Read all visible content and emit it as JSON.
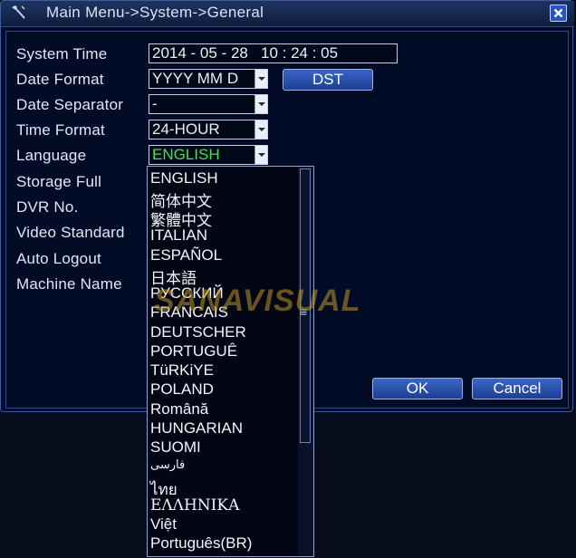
{
  "window": {
    "title": "Main Menu->System->General",
    "icon": "hammer-icon",
    "close_icon": "close-icon"
  },
  "form": {
    "system_time": {
      "label": "System Time",
      "value": "2014 - 05 - 28   10 : 24 : 05"
    },
    "date_format": {
      "label": "Date Format",
      "value": "YYYY MM D"
    },
    "date_separator": {
      "label": "Date Separator",
      "value": "-"
    },
    "time_format": {
      "label": "Time Format",
      "value": "24-HOUR"
    },
    "language": {
      "label": "Language",
      "value": "ENGLISH"
    },
    "storage_full": {
      "label": "Storage Full"
    },
    "dvr_no": {
      "label": "DVR No."
    },
    "video_standard": {
      "label": "Video Standard"
    },
    "auto_logout": {
      "label": "Auto Logout"
    },
    "machine_name": {
      "label": "Machine Name"
    }
  },
  "buttons": {
    "dst": "DST",
    "ok": "OK",
    "cancel": "Cancel"
  },
  "language_options": [
    "ENGLISH",
    "简体中文",
    "繁體中文",
    "ITALIAN",
    "ESPAÑOL",
    "日本語",
    "РУССКИЙ",
    "FRANCAIS",
    "DEUTSCHER",
    "PORTUGUÊ",
    "TüRKiYE",
    "POLAND",
    "Română",
    "HUNGARIAN",
    "SUOMI",
    "فارسی",
    "ไทย",
    "ΕΛΛΗΝΙΚΑ",
    "Việt",
    "Português(BR)"
  ],
  "watermark": "SANAVISUAL",
  "colors": {
    "background": "#020b26",
    "border": "#3a5d9a",
    "selected_text": "#45e15a",
    "button": "#2a55b8",
    "text": "#dfe7f7"
  }
}
